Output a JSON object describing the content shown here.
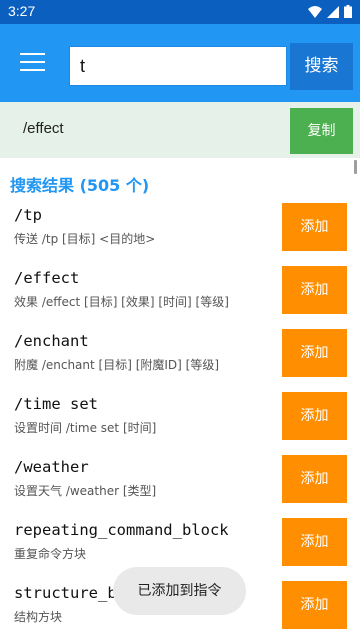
{
  "status_bar": {
    "time": "3:27"
  },
  "app_bar": {
    "search_value": "t",
    "search_button": "搜索"
  },
  "command_bar": {
    "command": "/effect",
    "copy_button": "复制"
  },
  "results": {
    "header": "搜索结果 (505 个)",
    "add_label": "添加",
    "items": [
      {
        "name": "/tp",
        "desc": "传送 /tp [目标] <目的地>"
      },
      {
        "name": "/effect",
        "desc": "效果 /effect [目标] [效果] [时间] [等级]"
      },
      {
        "name": "/enchant",
        "desc": "附魔 /enchant [目标] [附魔ID] [等级]"
      },
      {
        "name": "/time set",
        "desc": "设置时间 /time set [时间]"
      },
      {
        "name": "/weather",
        "desc": "设置天气 /weather [类型]"
      },
      {
        "name": "repeating_command_block",
        "desc": "重复命令方块"
      },
      {
        "name": "structure_block",
        "desc": "结构方块"
      }
    ]
  },
  "toast": {
    "message": "已添加到指令"
  },
  "colors": {
    "app_bar": "#2196f3",
    "add_button": "#ff8f00",
    "copy_button": "#4caf50",
    "header_text": "#2196f3"
  }
}
